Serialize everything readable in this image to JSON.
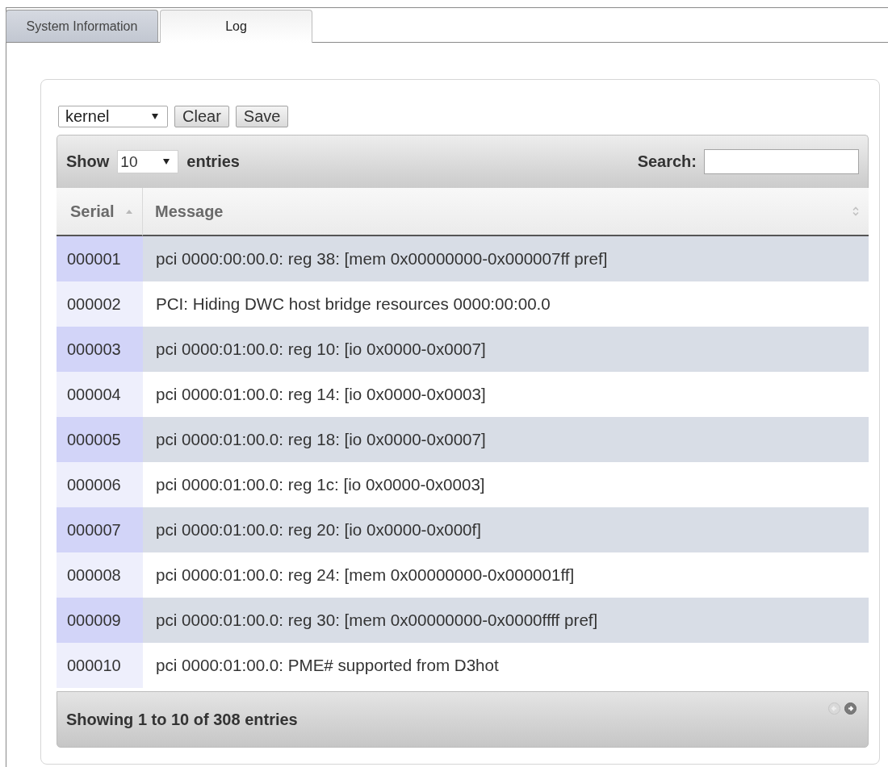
{
  "tabs": [
    {
      "label": "System Information",
      "selected": false
    },
    {
      "label": "Log",
      "selected": true
    }
  ],
  "log_controls": {
    "source": {
      "value": "kernel"
    },
    "buttons": [
      "Clear",
      "Save"
    ]
  },
  "table": {
    "length": {
      "label_before": "Show",
      "value": "10",
      "label_after": "entries"
    },
    "search": {
      "label": "Search:"
    },
    "columns": [
      {
        "label": "Serial",
        "sorted": true
      },
      {
        "label": "Message",
        "sorted": false
      }
    ],
    "rows": [
      {
        "serial": "000001",
        "message": "pci 0000:00:00.0: reg 38: [mem 0x00000000-0x000007ff pref]"
      },
      {
        "serial": "000002",
        "message": "PCI: Hiding DWC host bridge resources 0000:00:00.0"
      },
      {
        "serial": "000003",
        "message": "pci 0000:01:00.0: reg 10: [io 0x0000-0x0007]"
      },
      {
        "serial": "000004",
        "message": "pci 0000:01:00.0: reg 14: [io 0x0000-0x0003]"
      },
      {
        "serial": "000005",
        "message": "pci 0000:01:00.0: reg 18: [io 0x0000-0x0007]"
      },
      {
        "serial": "000006",
        "message": "pci 0000:01:00.0: reg 1c: [io 0x0000-0x0003]"
      },
      {
        "serial": "000007",
        "message": "pci 0000:01:00.0: reg 20: [io 0x0000-0x000f]"
      },
      {
        "serial": "000008",
        "message": "pci 0000:01:00.0: reg 24: [mem 0x00000000-0x000001ff]"
      },
      {
        "serial": "000009",
        "message": "pci 0000:01:00.0: reg 30: [mem 0x00000000-0x0000ffff pref]"
      },
      {
        "serial": "000010",
        "message": "pci 0000:01:00.0: PME# supported from D3hot"
      }
    ],
    "info": "Showing 1 to 10 of 308 entries",
    "pagination": [
      {
        "kind": "previous",
        "disabled": true
      },
      {
        "kind": "next",
        "disabled": false
      }
    ]
  }
}
